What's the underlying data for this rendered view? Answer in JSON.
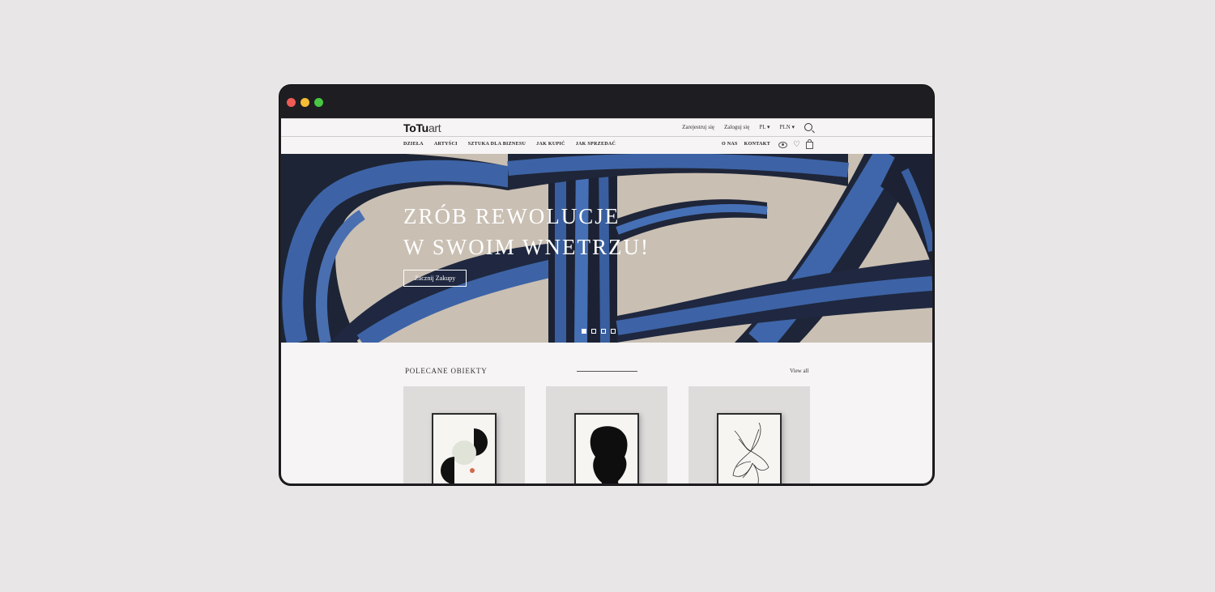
{
  "site": {
    "logo_bold": "ToTu",
    "logo_light": "art"
  },
  "topbar": {
    "register": "Zarejestruj się",
    "login": "Zaloguj się",
    "language": "PL ▾",
    "currency": "PLN ▾",
    "search_icon": "search-icon"
  },
  "nav": {
    "items": [
      "DZIEŁA",
      "ARTYŚCI",
      "SZTUKA DLA BIZNESU",
      "JAK KUPIĆ",
      "JAK SPRZEDAĆ"
    ],
    "right_items": [
      "O NAS",
      "KONTAKT"
    ],
    "icons": [
      "eye-icon",
      "heart-icon",
      "bag-icon"
    ]
  },
  "hero": {
    "title_line1": "ZRÓB REWOLUCJE",
    "title_line2": "W SWOIM WNETRZU!",
    "button_label": "Zacznij Zakupy",
    "slides": 4,
    "active_slide": 1,
    "colors": {
      "blue": "#3a5fa0",
      "dark": "#1a1e2a",
      "beige": "#c9bfb3"
    }
  },
  "featured": {
    "title": "POLECANE OBIEKTY",
    "view_all": "View all",
    "items": [
      "abstract-circles-artwork",
      "black-silhouette-artwork",
      "flower-sketch-artwork"
    ]
  }
}
